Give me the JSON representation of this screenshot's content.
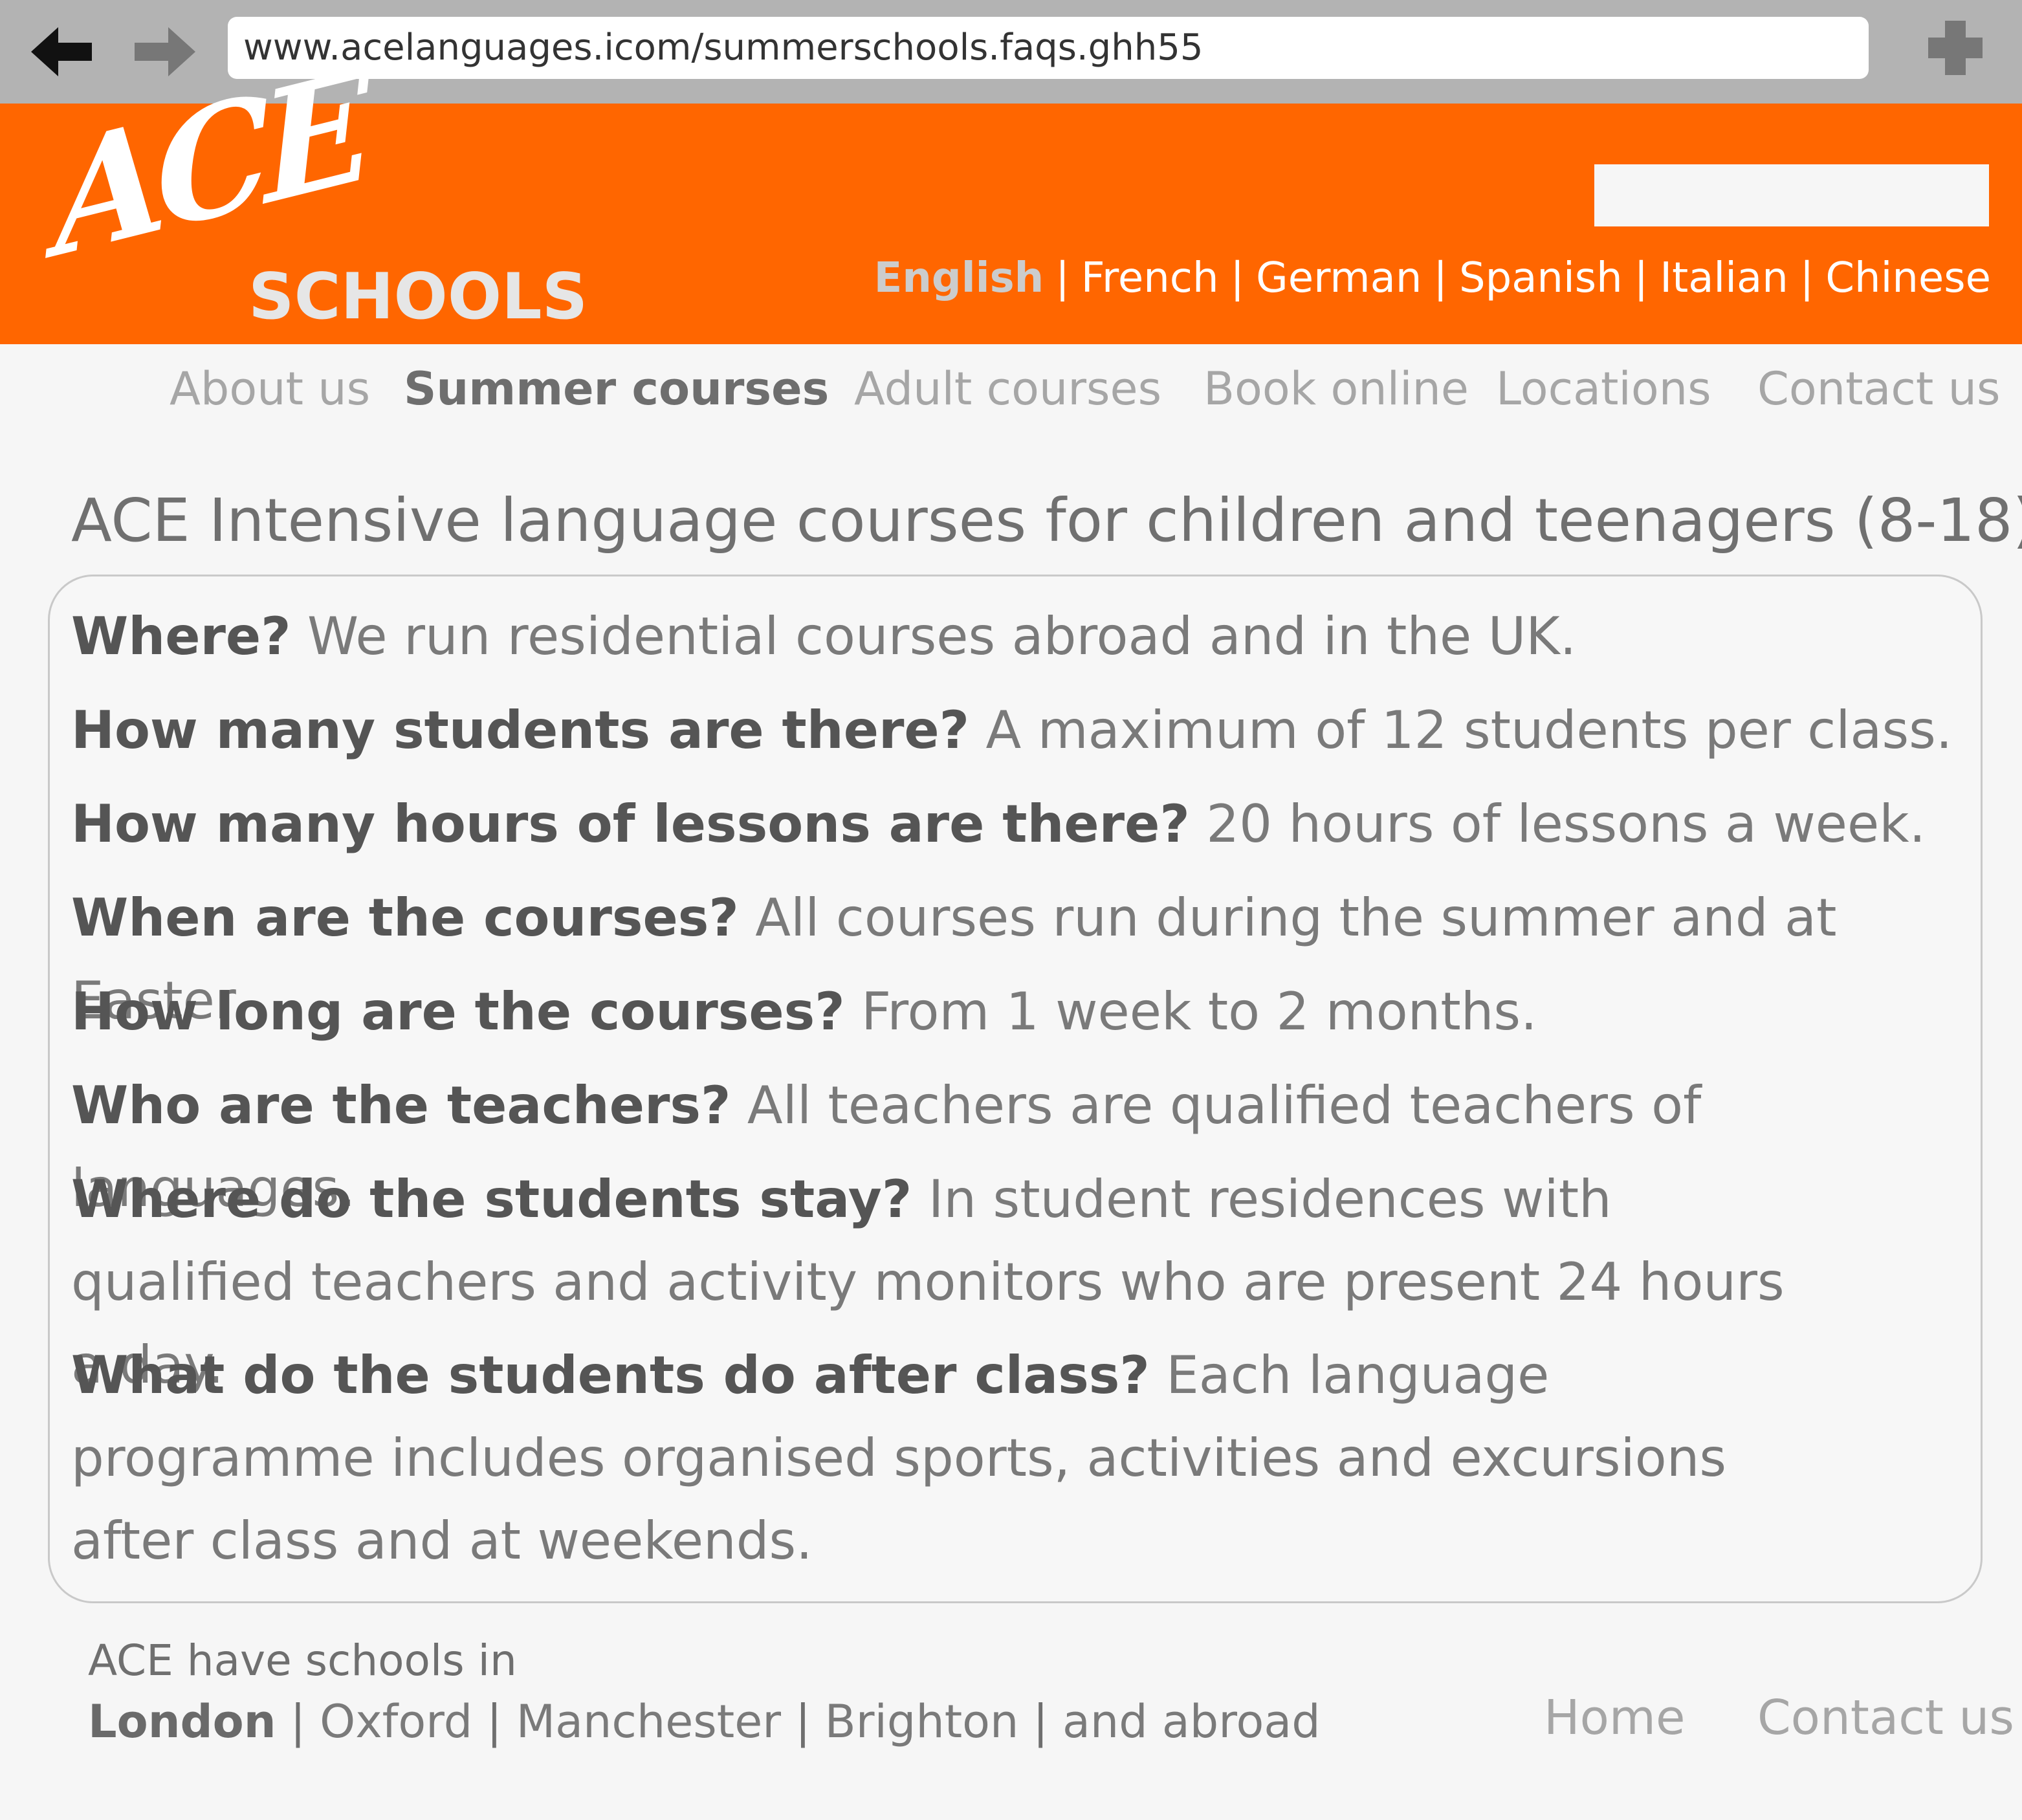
{
  "browser": {
    "url": "www.acelanguages.icom/summerschools.faqs.ghh55",
    "back_icon": "arrow-left-icon",
    "forward_icon": "arrow-right-icon",
    "new_tab_icon": "plus-icon"
  },
  "header": {
    "logo_ace": "ACE",
    "logo_schools": "SCHOOLS",
    "search_value": "",
    "languages": [
      "English",
      "French",
      "German",
      "Spanish",
      "Italian",
      "Chinese"
    ],
    "active_language": "English"
  },
  "nav": {
    "items": [
      "About us",
      "Summer courses",
      "Adult courses",
      "Book online",
      "Locations",
      "Contact us"
    ],
    "active": "Summer courses"
  },
  "main": {
    "title": "ACE Intensive language courses for children and teenagers (8-18)",
    "faqs": [
      {
        "q": "Where?",
        "a": "We run residential courses abroad and in the UK."
      },
      {
        "q": "How many students are there?",
        "a": "A maximum of 12 students per class."
      },
      {
        "q": "How many hours of lessons are there?",
        "a": "20 hours of lessons a week."
      },
      {
        "q": "When are the courses?",
        "a": "All courses run during the summer and at Easter."
      },
      {
        "q": "How long are the courses?",
        "a": "From 1 week to 2 months."
      },
      {
        "q": "Who are the teachers?",
        "a": "All teachers are qualified teachers of languages."
      },
      {
        "q": "Where do the students stay?",
        "a": "In student residences with qualified teachers and activity monitors who are present 24 hours a day."
      },
      {
        "q": "What do the students do after class?",
        "a": "Each language programme includes organised sports, activities and excursions after class and at weekends."
      }
    ]
  },
  "footer": {
    "intro": "ACE have schools in",
    "cities": [
      "London",
      "Oxford",
      "Manchester",
      "Brighton",
      "and abroad"
    ],
    "current_city": "London",
    "home_label": "Home",
    "contact_label": "Contact us"
  },
  "colors": {
    "brand_orange": "#ff6600",
    "browser_chrome": "#b3b3b3",
    "page_background": "#f6f6f6"
  }
}
